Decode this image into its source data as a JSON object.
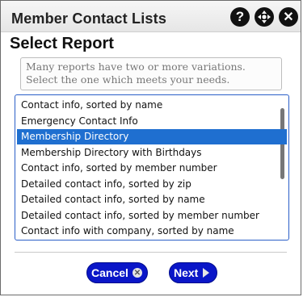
{
  "window": {
    "title": "Member Contact Lists"
  },
  "titlebar_icons": [
    "help-icon",
    "move-icon",
    "close-icon"
  ],
  "heading": "Select Report",
  "description": "Many reports have two or more variations. Select the one which meets your needs.",
  "reports": [
    "Contact info, sorted by name",
    "Emergency Contact Info",
    "Membership Directory",
    "Membership Directory with Birthdays",
    "Contact info, sorted by member number",
    "Detailed contact info, sorted by zip",
    "Detailed contact info, sorted by name",
    "Detailed contact info, sorted by member number",
    "Contact info with company, sorted by name"
  ],
  "selected_report": "Membership Directory",
  "buttons": {
    "cancel": "Cancel",
    "next": "Next"
  },
  "colors": {
    "accent": "#0a16c8",
    "selection": "#1f6fd0",
    "list_border": "#2b5fc8"
  }
}
